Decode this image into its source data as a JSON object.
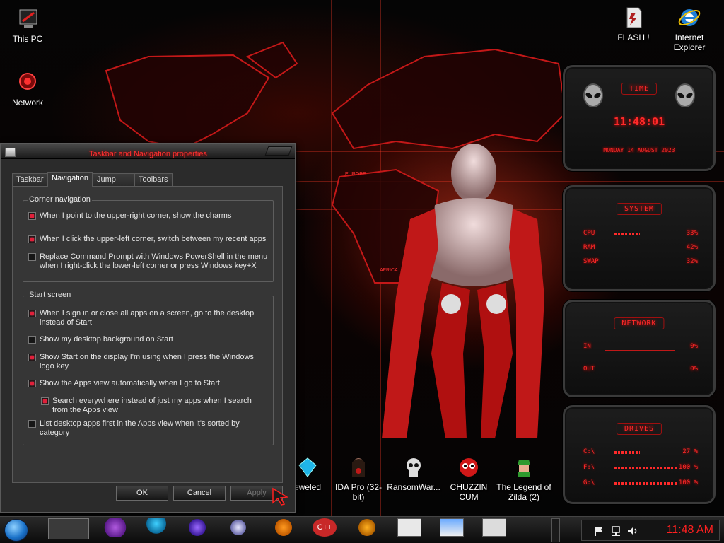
{
  "desktop": {
    "icons_left": [
      {
        "label": "This PC",
        "icon": "computer-icon"
      },
      {
        "label": "Network",
        "icon": "network-icon"
      }
    ],
    "icons_right": [
      {
        "label": "FLASH !",
        "icon": "flash-document-icon"
      },
      {
        "label": "Internet Explorer",
        "icon": "internet-explorer-icon"
      }
    ],
    "icons_bottom": [
      {
        "label": "eweled",
        "icon": "jewel-icon"
      },
      {
        "label": "IDA Pro (32-bit)",
        "icon": "ida-pro-icon"
      },
      {
        "label": "RansomWar...",
        "icon": "skull-icon"
      },
      {
        "label": "CHUZZIN CUM",
        "icon": "chuzzle-icon"
      },
      {
        "label": "The Legend of Zilda (2)",
        "icon": "zelda-icon"
      }
    ],
    "map_labels": [
      "EUROPE",
      "AFRICA"
    ]
  },
  "gadgets": {
    "time": {
      "title": "TIME",
      "clock": "11:48:01",
      "date": "MONDAY 14 AUGUST 2023"
    },
    "system": {
      "title": "SYSTEM",
      "rows": [
        {
          "label": "CPU",
          "value": "33%"
        },
        {
          "label": "RAM",
          "value": "42%"
        },
        {
          "label": "SWAP",
          "value": "32%"
        }
      ]
    },
    "network": {
      "title": "NETWORK",
      "rows": [
        {
          "label": "IN",
          "value": "0%"
        },
        {
          "label": "OUT",
          "value": "0%"
        }
      ]
    },
    "drives": {
      "title": "DRIVES",
      "rows": [
        {
          "label": "C:\\",
          "value": "27 %"
        },
        {
          "label": "F:\\",
          "value": "100 %"
        },
        {
          "label": "G:\\",
          "value": "100 %"
        }
      ]
    }
  },
  "dialog": {
    "title": "Taskbar and Navigation properties",
    "tabs": [
      "Taskbar",
      "Navigation",
      "Jump Lists",
      "Toolbars"
    ],
    "active_tab": "Navigation",
    "corner_navigation": {
      "legend": "Corner navigation",
      "options": [
        {
          "label": "When I point to the upper-right corner, show the charms",
          "checked": true
        },
        {
          "label": "When I click the upper-left corner, switch between my recent apps",
          "checked": true
        },
        {
          "label": "Replace Command Prompt with Windows PowerShell in the menu when I right-click the lower-left corner or press Windows key+X",
          "checked": false
        }
      ]
    },
    "start_screen": {
      "legend": "Start screen",
      "options": [
        {
          "label": "When I sign in or close all apps on a screen, go to the desktop instead of Start",
          "checked": true
        },
        {
          "label": "Show my desktop background on Start",
          "checked": false
        },
        {
          "label": "Show Start on the display I'm using when I press the Windows logo key",
          "checked": true
        },
        {
          "label": "Show the Apps view automatically when I go to Start",
          "checked": true
        },
        {
          "label": "Search everywhere instead of just my apps when I search from the Apps view",
          "checked": true
        },
        {
          "label": "List desktop apps first in the Apps view when it's sorted by category",
          "checked": false
        }
      ]
    },
    "buttons": {
      "ok": "OK",
      "cancel": "Cancel",
      "apply": "Apply"
    }
  },
  "taskbar": {
    "pinned_icons": [
      "explorer-window-icon",
      "paint-icon",
      "gem-icon",
      "download-icon",
      "search-icon",
      "vlc-icon",
      "cpp-icon",
      "tool-icon",
      "calculator-icon",
      "notepad-icon",
      "scissors-icon"
    ],
    "tray_icons": [
      "flag-icon",
      "network-icon",
      "speaker-icon"
    ],
    "clock": "11:48 AM"
  },
  "colors": {
    "accent": "#ff2a2a",
    "checkbox_on": "#e0203a",
    "start_orb": "#1a72c9"
  }
}
